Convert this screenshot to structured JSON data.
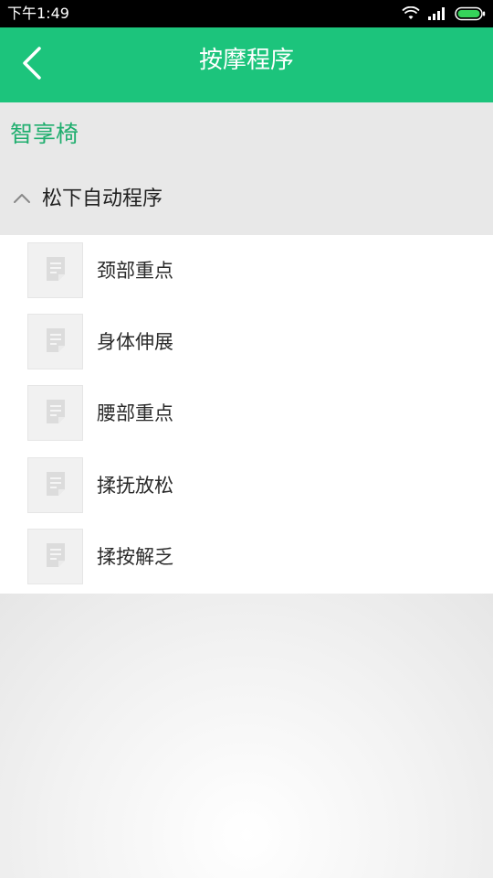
{
  "status_bar": {
    "time": "下午1:49",
    "icons": [
      "wifi-icon",
      "signal-icon",
      "battery-icon"
    ]
  },
  "app_bar": {
    "title": "按摩程序",
    "back_icon": "chevron-left-icon",
    "background": "#1cc47c"
  },
  "brand": {
    "label": "智享椅",
    "color": "#1fae6e"
  },
  "section": {
    "label": "松下自动程序",
    "expanded": true,
    "icon": "chevron-up-icon"
  },
  "programs": [
    {
      "label": "颈部重点",
      "icon": "document-icon"
    },
    {
      "label": "身体伸展",
      "icon": "document-icon"
    },
    {
      "label": "腰部重点",
      "icon": "document-icon"
    },
    {
      "label": "揉抚放松",
      "icon": "document-icon"
    },
    {
      "label": "揉按解乏",
      "icon": "document-icon"
    }
  ]
}
